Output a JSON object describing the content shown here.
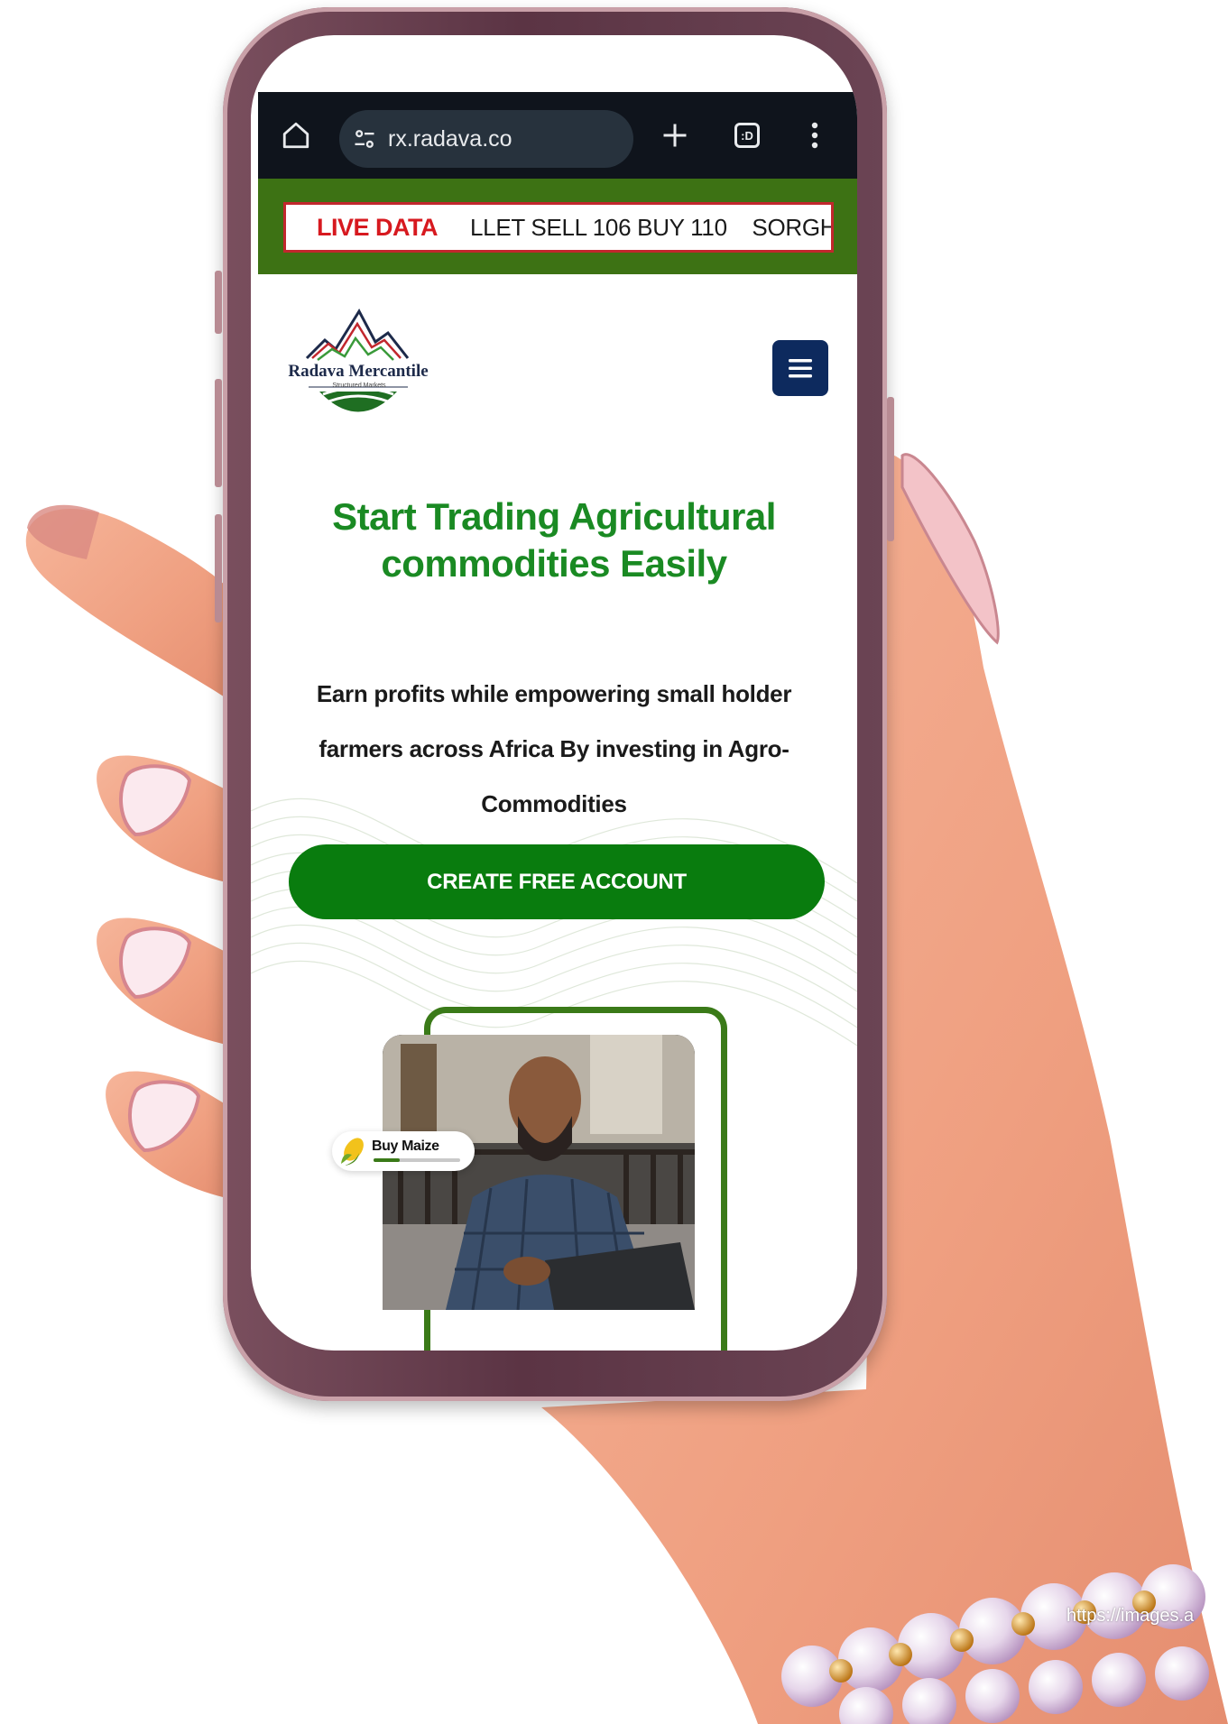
{
  "browser": {
    "url": "rx.radava.co",
    "tab_count_label": ":D"
  },
  "ticker": {
    "label": "LIVE DATA",
    "text": "LLET SELL 106 BUY 110    SORGH"
  },
  "header": {
    "logo_name": "Radava Mercantile",
    "logo_tagline": "Structured Markets"
  },
  "hero": {
    "title": "Start Trading Agricultural commodities Easily",
    "subtitle": "Earn profits while empowering small holder farmers across Africa By investing in Agro-Commodities",
    "cta_label": "CREATE FREE ACCOUNT"
  },
  "card": {
    "chip_label": "Buy Maize",
    "chip_progress": 0.3
  },
  "watermark": "https://images.a",
  "colors": {
    "brand_green": "#1a8a23",
    "cta_green": "#097c0e",
    "ticker_band": "#3d7214",
    "live_red": "#d7191f",
    "hamburger_navy": "#0d2a5e",
    "browser_bar": "#0f141c"
  },
  "icons": [
    "home-icon",
    "site-settings-icon",
    "new-tab-icon",
    "tab-switcher-icon",
    "overflow-menu-icon",
    "hamburger-icon",
    "corn-icon"
  ]
}
